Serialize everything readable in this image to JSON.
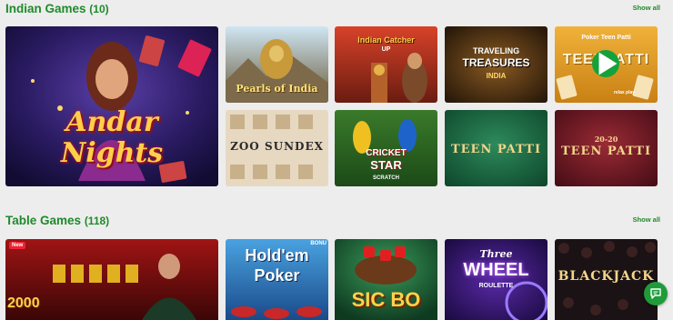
{
  "sections": [
    {
      "title": "Indian Games",
      "count": "(10)",
      "show_all": "Show all",
      "games": [
        {
          "label_1": "Andar",
          "label_2": "Nights"
        },
        {
          "label_1": "Pearls of India"
        },
        {
          "label_1": "Indian Catcher",
          "label_2": "UP"
        },
        {
          "label_1": "TRAVELING",
          "label_2": "TREASURES",
          "label_3": "INDIA"
        },
        {
          "label_1": "Poker Teen Patti",
          "label_2": "TEENPATTI",
          "label_3": "relax play"
        },
        {
          "label_1": "ZOO SUNDEX"
        },
        {
          "label_1": "CRICKET",
          "label_2": "STAR",
          "label_3": "SCRATCH"
        },
        {
          "label_1": "TEEN PATTI"
        },
        {
          "label_1": "20-20",
          "label_2": "TEEN PATTI"
        }
      ]
    },
    {
      "title": "Table Games",
      "count": "(118)",
      "show_all": "Show all",
      "games": [
        {
          "label_1": "New",
          "label_2": "2000"
        },
        {
          "label_1": "Hold'em",
          "label_2": "Poker",
          "label_3": "BONU"
        },
        {
          "label_1": "SIC BO"
        },
        {
          "label_1": "Three",
          "label_2": "WHEEL",
          "label_3": "ROULETTE"
        },
        {
          "label_1": "BLACKJACK"
        }
      ]
    }
  ],
  "colors": {
    "accent": "#1f8a2b",
    "background": "#ededed"
  },
  "icons": {
    "play": "play-icon",
    "chat": "chat-icon"
  }
}
